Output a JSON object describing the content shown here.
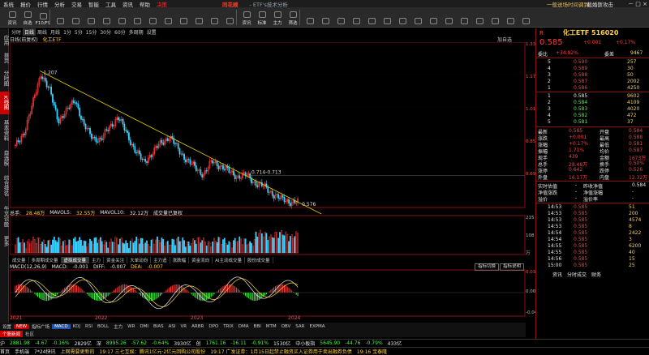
{
  "menu": {
    "items": [
      "系统",
      "报价",
      "行情",
      "分析",
      "交易",
      "智能",
      "工具",
      "资讯",
      "帮助",
      "决策"
    ],
    "logo": "同花顺",
    "subtitle": "- ETF's技术分析",
    "promo": "一般送场时间调到",
    "promo2": "截婚斯攻击"
  },
  "toolbar": {
    "buttons": [
      "资讯",
      "自选",
      "F10/F9",
      "",
      "",
      "",
      "",
      "",
      "",
      "",
      "",
      "",
      "",
      "",
      "",
      "资讯",
      "标准",
      "主力",
      "筛选",
      "",
      "",
      "",
      "",
      "",
      "",
      "",
      "",
      "",
      "",
      "",
      "",
      "",
      "",
      ""
    ]
  },
  "sidebar": {
    "items": [
      "应用",
      "首页",
      "分时图",
      "K线图",
      "基本资料",
      "自选股",
      "综合排名",
      "牛叉诊股",
      "更多"
    ],
    "active_index": 3
  },
  "period_bar": {
    "items": [
      "分时",
      "日线",
      "周线",
      "月线",
      "1分",
      "5分",
      "15分",
      "30分",
      "60分",
      "多周期",
      "设置"
    ],
    "active_index": 1
  },
  "kline_title": {
    "left": "日线(前复权)",
    "name": "化工ETF",
    "right_label": "加自选"
  },
  "price_axis": [
    "1.337",
    "1.176",
    "1.016",
    "0.857",
    "0.697"
  ],
  "annotations": {
    "high": "1.207",
    "mid": "0.714-0.713",
    "low": "0.576"
  },
  "volume": {
    "header_label": "总手:",
    "total": "28.48万",
    "ma5_label": "MAVOL5:",
    "ma5": "32.55万",
    "ma10_label": "MAVOL10:",
    "ma10": "32.12万",
    "extra": "成交量已复权",
    "axis": [
      "215",
      "108",
      "万"
    ]
  },
  "sub_tabs": [
    "成交量",
    "多周期成交量",
    "虚拟成交量",
    "主力",
    "资金关注",
    "大单动向",
    "主力追",
    "涨跌幅",
    "资金流向",
    "AI主动成交量",
    "股份成交量"
  ],
  "sub_tabs_active": 2,
  "macd": {
    "header": "MACD(12,26,9)",
    "macd_label": "MACD:",
    "macd": "-0.001",
    "diff_label": "DIFF:",
    "diff": "-0.007",
    "dea_label": "DEA:",
    "dea": "-0.007",
    "axis": [
      "0.037",
      "0.000",
      "-0.040"
    ],
    "btn1": "指标切换",
    "btn2": "指标说明"
  },
  "x_axis": [
    "2021",
    "2022",
    "2023",
    "2024"
  ],
  "indicator_tabs": [
    "设置",
    "NEW",
    "指标广场",
    "MACD",
    "KDJ",
    "RSI",
    "BOLL",
    "主力",
    "WR",
    "DMI",
    "BIAS",
    "ASI",
    "VR",
    "ARBR",
    "DPO",
    "TRIX",
    "DMA",
    "BBI",
    "MTM",
    "OBV",
    "SAR",
    "EXPMA"
  ],
  "indicator_active": 3,
  "bottom_tabs": [
    "个股新闻",
    "社区"
  ],
  "chart_data": {
    "type": "candlestick",
    "title": "化工ETF",
    "period": "日线(前复权)",
    "x_range": [
      "2021",
      "2024"
    ],
    "y_range": [
      0.576,
      1.337
    ],
    "high_point": 1.207,
    "low_point": 0.576,
    "last_price": 0.585,
    "trendline": {
      "from": 1.207,
      "to": 0.576
    },
    "series": [
      {
        "name": "close",
        "values": [
          0.85,
          0.92,
          1.05,
          1.207,
          1.12,
          0.98,
          1.02,
          1.08,
          0.95,
          0.9,
          0.88,
          0.95,
          0.99,
          0.92,
          0.83,
          0.78,
          0.82,
          0.87,
          0.9,
          0.84,
          0.79,
          0.75,
          0.72,
          0.78,
          0.76,
          0.73,
          0.71,
          0.714,
          0.68,
          0.66,
          0.63,
          0.6,
          0.59,
          0.585
        ]
      }
    ]
  },
  "quote": {
    "r_label": "R",
    "name": "化工ETF 516020",
    "price": "0.585",
    "change": "+0.001",
    "change_pct": "+0.17%",
    "stats": [
      {
        "k": "委比",
        "v": "+34.82%",
        "k2": "委差",
        "v2": "9467"
      }
    ],
    "asks": [
      {
        "lv": "5",
        "p": "0.590",
        "v": "257"
      },
      {
        "lv": "4",
        "p": "0.589",
        "v": "30"
      },
      {
        "lv": "3",
        "p": "0.588",
        "v": "50"
      },
      {
        "lv": "2",
        "p": "0.587",
        "v": "2002"
      },
      {
        "lv": "1",
        "p": "0.586",
        "v": "4250"
      }
    ],
    "bids": [
      {
        "lv": "1",
        "p": "0.585",
        "v": "9602"
      },
      {
        "lv": "2",
        "p": "0.584",
        "v": "4109"
      },
      {
        "lv": "3",
        "p": "0.583",
        "v": "4020"
      },
      {
        "lv": "4",
        "p": "0.582",
        "v": "472"
      },
      {
        "lv": "5",
        "p": "0.581",
        "v": "37"
      }
    ],
    "info": [
      {
        "k": "最新",
        "v": "0.585",
        "k2": "开盘",
        "v2": "0.584"
      },
      {
        "k": "涨跌",
        "v": "+0.001",
        "k2": "最高",
        "v2": "0.588"
      },
      {
        "k": "涨幅",
        "v": "+0.17%",
        "k2": "最低",
        "v2": "0.581"
      },
      {
        "k": "振幅",
        "v": "1.71%",
        "k2": "均价",
        "v2": "0.587"
      },
      {
        "k": "现手",
        "v": "439",
        "k2": "金额",
        "v2": "1673万"
      },
      {
        "k": "总手",
        "v": "28.48万",
        "k2": "换手",
        "v2": "0.50%"
      },
      {
        "k": "涨停",
        "v": "0.642",
        "k2": "跌停",
        "v2": "0.526"
      },
      {
        "k": "外盘",
        "v": "16.17万",
        "k2": "内盘",
        "v2": "12.32万"
      }
    ],
    "nav": [
      {
        "k": "实时估值",
        "v": "-",
        "k2": "昨收净值",
        "v2": "0.584"
      },
      {
        "k": "净值涨跌",
        "v": "-",
        "k2": "净值涨幅",
        "v2": "-"
      },
      {
        "k": "溢价",
        "v": "-",
        "k2": "溢价率",
        "v2": "-"
      }
    ],
    "ticks": [
      {
        "t": "14:53",
        "p": "0.585",
        "v": "51"
      },
      {
        "t": "14:53",
        "p": "0.585",
        "v": "200"
      },
      {
        "t": "14:53",
        "p": "0.585",
        "v": "4574"
      },
      {
        "t": "14:53",
        "p": "0.585",
        "v": "8"
      },
      {
        "t": "14:54",
        "p": "0.585",
        "v": "2422"
      },
      {
        "t": "14:54",
        "p": "0.585",
        "v": "3"
      },
      {
        "t": "14:55",
        "p": "0.585",
        "v": "6200"
      },
      {
        "t": "14:55",
        "p": "0.585",
        "v": "40"
      },
      {
        "t": "14:56",
        "p": "0.585",
        "v": "15"
      },
      {
        "t": "15:00",
        "p": "0.585",
        "v": "25"
      }
    ],
    "tabs": [
      "资讯",
      "分时成交",
      "财务"
    ]
  },
  "status": {
    "line1": [
      {
        "t": "沪",
        "c": "wh"
      },
      {
        "t": "2881.98",
        "c": "dn"
      },
      {
        "t": "-4.67",
        "c": "dn"
      },
      {
        "t": "-0.16%",
        "c": "dn"
      },
      {
        "t": "2829亿",
        "c": "wh"
      },
      {
        "t": "深",
        "c": "wh"
      },
      {
        "t": "8995.26",
        "c": "dn"
      },
      {
        "t": "-57.62",
        "c": "dn"
      },
      {
        "t": "-0.64%",
        "c": "dn"
      },
      {
        "t": "3930亿",
        "c": "wh"
      },
      {
        "t": "创",
        "c": "wh"
      },
      {
        "t": "1761.16",
        "c": "dn"
      },
      {
        "t": "-16.11",
        "c": "dn"
      },
      {
        "t": "-0.91%",
        "c": "dn"
      },
      {
        "t": "1530亿",
        "c": "wh"
      },
      {
        "t": "中小板指",
        "c": "wh"
      },
      {
        "t": "5645.90",
        "c": "dn"
      },
      {
        "t": "-44.76",
        "c": "dn"
      },
      {
        "t": "-0.79%",
        "c": "dn"
      },
      {
        "t": "433亿",
        "c": "wh"
      }
    ],
    "line2": [
      {
        "t": "首页",
        "c": "wh"
      },
      {
        "t": "手机端",
        "c": "wh"
      },
      {
        "t": "7*24快讯",
        "c": "wh"
      },
      {
        "t": "上网需要更新的",
        "c": "yl"
      },
      {
        "t": "19:17 三七互娱：腾讯1亿元·2亿元回购公司股份",
        "c": "yl"
      },
      {
        "t": "19:17 广发证券：1月15日起禁止融资买入证券用于卖出融券负债",
        "c": "yl"
      },
      {
        "t": "19:16 宝泰隆",
        "c": "yl"
      }
    ]
  }
}
